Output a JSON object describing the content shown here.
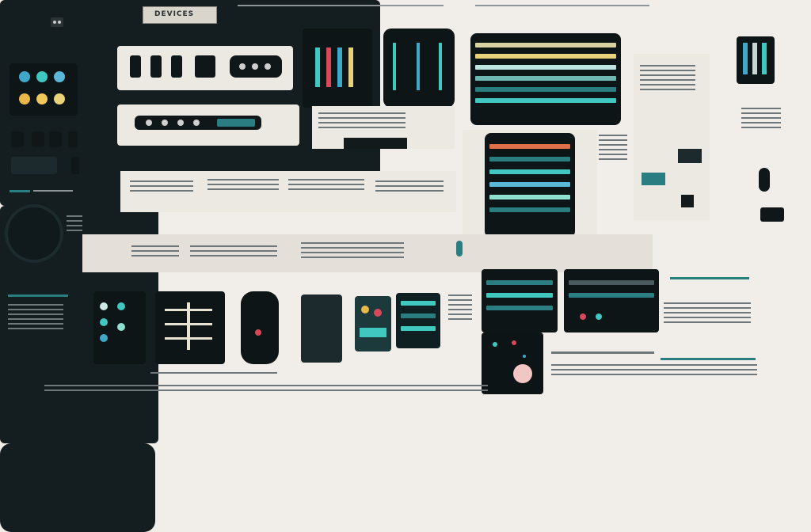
{
  "header": {
    "badge_label": "DEVICES"
  },
  "colors": {
    "background": "#f1eeea",
    "panel_dark": "#141d20",
    "accent_teal": "#2a7d80",
    "accent_cyan": "#3fc7c0",
    "accent_yellow": "#e8d27a",
    "accent_red": "#d6485a",
    "text_gray": "#6e777a"
  },
  "icons": [
    "cassette-icon",
    "speaker-knob-icon",
    "power-button-icon",
    "headphone-icon"
  ]
}
